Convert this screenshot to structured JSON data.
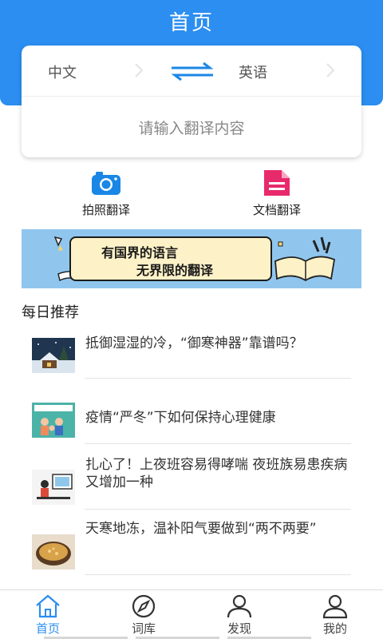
{
  "header": {
    "title": "首页"
  },
  "translator": {
    "source_lang": "中文",
    "target_lang": "英语",
    "input_placeholder": "请输入翻译内容"
  },
  "tools": [
    {
      "label": "拍照翻译",
      "icon": "camera-icon"
    },
    {
      "label": "文档翻译",
      "icon": "document-icon"
    }
  ],
  "banner": {
    "line1": "有国界的语言",
    "line2": "无界限的翻译"
  },
  "recommend": {
    "title": "每日推荐",
    "items": [
      {
        "text": "抵御湿湿的冷，“御寒神器”靠谱吗？"
      },
      {
        "text": "疫情“严冬”下如何保持心理健康"
      },
      {
        "text": "扎心了！上夜班容易得哮喘 夜班族易患疾病又增加一种"
      },
      {
        "text": "天寒地冻，温补阳气要做到“两不两要”"
      }
    ]
  },
  "tabbar": {
    "items": [
      {
        "label": "首页",
        "icon": "home-icon",
        "active": true
      },
      {
        "label": "词库",
        "icon": "compass-icon",
        "active": false
      },
      {
        "label": "发现",
        "icon": "user-icon",
        "active": false
      },
      {
        "label": "我的",
        "icon": "profile-icon",
        "active": false
      }
    ]
  },
  "colors": {
    "primary": "#2b8ef0",
    "document_icon": "#e8296b",
    "camera_icon": "#1a87e6",
    "banner_bg": "#90c6ee"
  }
}
